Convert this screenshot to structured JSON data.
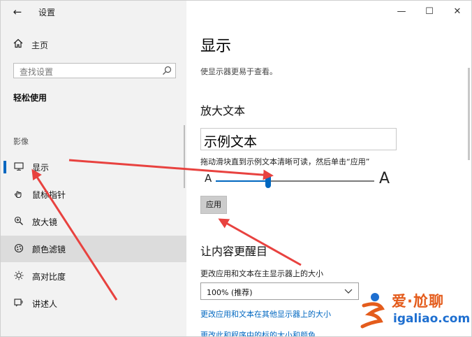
{
  "window": {
    "title": "设置",
    "back_glyph": "←",
    "minimize_glyph": "—",
    "maximize_glyph": "☐",
    "close_glyph": "✕"
  },
  "sidebar": {
    "home": {
      "icon": "home-icon",
      "label": "主页"
    },
    "search": {
      "placeholder": "查找设置",
      "icon": "search-icon"
    },
    "section_title": "轻松使用",
    "group_label": "影像",
    "items": [
      {
        "icon": "monitor-icon",
        "label": "显示",
        "selected": true
      },
      {
        "icon": "mouse-pointer-icon",
        "label": "鼠标指针"
      },
      {
        "icon": "magnifier-icon",
        "label": "放大镜"
      },
      {
        "icon": "color-filter-icon",
        "label": "颜色滤镜",
        "hover": true
      },
      {
        "icon": "high-contrast-icon",
        "label": "高对比度"
      },
      {
        "icon": "narrator-icon",
        "label": "讲述人"
      }
    ]
  },
  "main": {
    "title": "显示",
    "description": "使显示器更易于查看。",
    "enlarge_text": {
      "heading": "放大文本",
      "sample_text": "示例文本",
      "hint": "拖动滑块直到示例文本清晰可读，然后单击“应用”",
      "small_label": "A",
      "large_label": "A",
      "slider_fraction": 0.33,
      "apply_label": "应用"
    },
    "brighter": {
      "heading": "让内容更醒目",
      "scale_label": "更改应用和文本在主显示器上的大小",
      "scale_value": "100% (推荐)",
      "link1": "更改应用和文本在其他显示器上的大小",
      "link2": "更改此和程序中的标的大小和颜色"
    }
  },
  "watermark": {
    "brand": "爱·尬聊",
    "domain": "igaliao.com"
  },
  "colors": {
    "accent": "#0067c0",
    "annotation": "#e8423f",
    "sidebar_bg": "#f2f2f2",
    "hover_bg": "#dcdcdc"
  }
}
